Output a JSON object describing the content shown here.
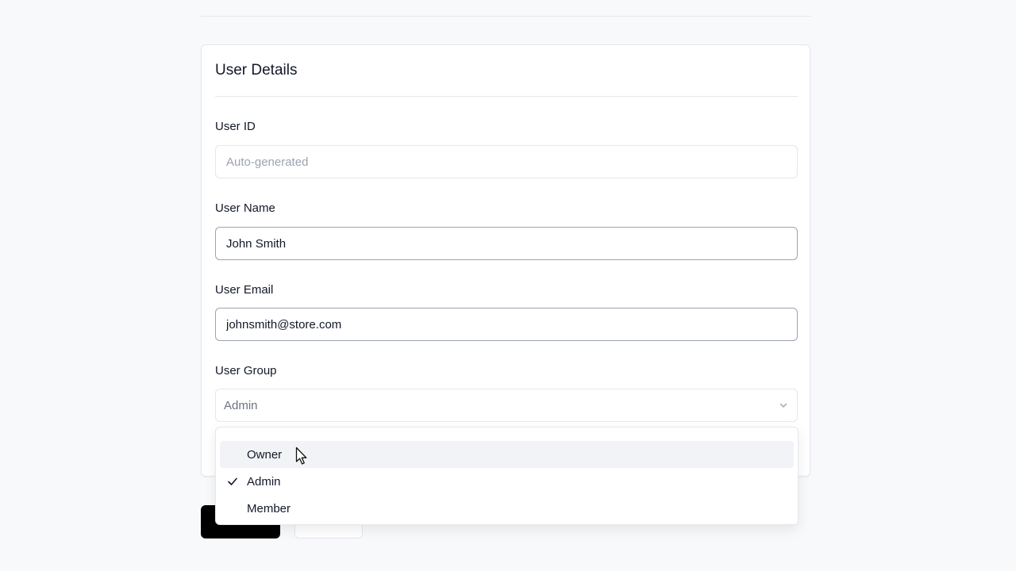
{
  "form": {
    "title": "User Details",
    "fields": {
      "user_id": {
        "label": "User ID",
        "value": "",
        "placeholder": "Auto-generated"
      },
      "user_name": {
        "label": "User Name",
        "value": "John Smith"
      },
      "user_email": {
        "label": "User Email",
        "value": "johnsmith@store.com"
      },
      "user_group": {
        "label": "User Group",
        "selected": "Admin",
        "options": [
          {
            "label": "Owner",
            "checked": false,
            "hovered": true
          },
          {
            "label": "Admin",
            "checked": true,
            "hovered": false
          },
          {
            "label": "Member",
            "checked": false,
            "hovered": false
          }
        ]
      }
    }
  },
  "icons": {
    "select_chevron": "chevron-down-icon",
    "option_check": "check-icon",
    "pointer": "mouse-pointer-icon"
  },
  "colors": {
    "primary_button": "#000000",
    "hover_background": "#f1f3f6",
    "border": "#e5e7eb"
  }
}
